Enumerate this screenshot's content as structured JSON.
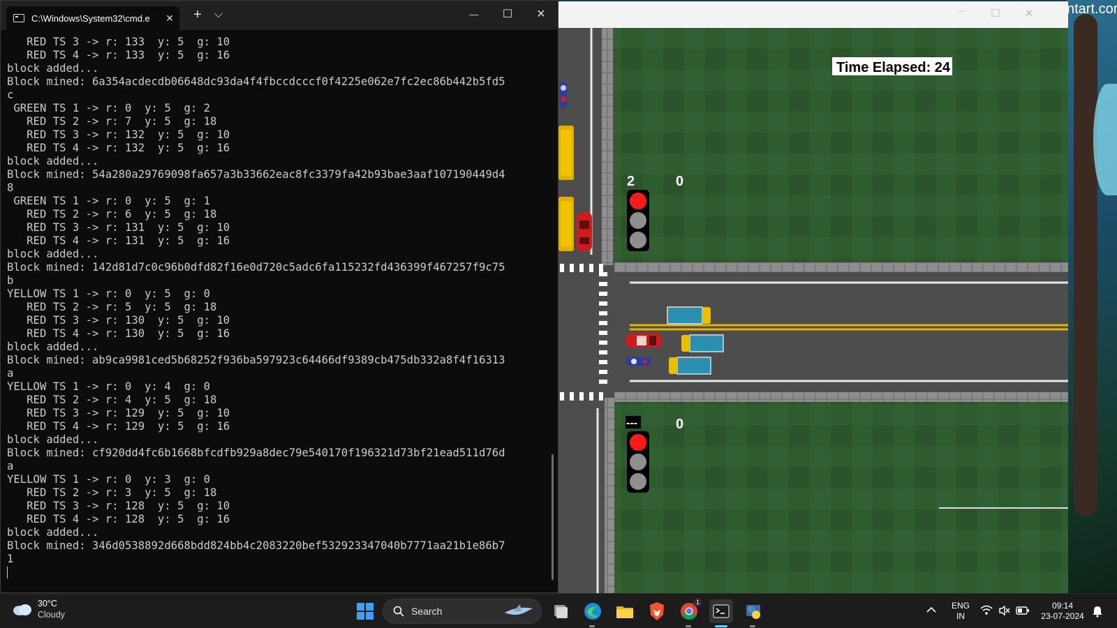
{
  "wallpaper": {
    "brand_text": "ntart.com"
  },
  "terminal": {
    "tab_title": "C:\\Windows\\System32\\cmd.e",
    "tab_close": "✕",
    "new_tab": "+",
    "dropdown": "⌵",
    "minimize": "—",
    "maximize": "☐",
    "close": "✕",
    "lines": [
      "   RED TS 3 -> r: 133  y: 5  g: 10",
      "   RED TS 4 -> r: 133  y: 5  g: 16",
      "block added...",
      "Block mined: 6a354acdecdb06648dc93da4f4fbccdcccf0f4225e062e7fc2ec86b442b5fd5",
      "c",
      " GREEN TS 1 -> r: 0  y: 5  g: 2",
      "   RED TS 2 -> r: 7  y: 5  g: 18",
      "   RED TS 3 -> r: 132  y: 5  g: 10",
      "   RED TS 4 -> r: 132  y: 5  g: 16",
      "block added...",
      "Block mined: 54a280a29769098fa657a3b33662eac8fc3379fa42b93bae3aaf107190449d4",
      "8",
      " GREEN TS 1 -> r: 0  y: 5  g: 1",
      "   RED TS 2 -> r: 6  y: 5  g: 18",
      "   RED TS 3 -> r: 131  y: 5  g: 10",
      "   RED TS 4 -> r: 131  y: 5  g: 16",
      "block added...",
      "Block mined: 142d81d7c0c96b0dfd82f16e0d720c5adc6fa115232fd436399f467257f9c75",
      "b",
      "YELLOW TS 1 -> r: 0  y: 5  g: 0",
      "   RED TS 2 -> r: 5  y: 5  g: 18",
      "   RED TS 3 -> r: 130  y: 5  g: 10",
      "   RED TS 4 -> r: 130  y: 5  g: 16",
      "block added...",
      "Block mined: ab9ca9981ced5b68252f936ba597923c64466df9389cb475db332a8f4f16313",
      "a",
      "YELLOW TS 1 -> r: 0  y: 4  g: 0",
      "   RED TS 2 -> r: 4  y: 5  g: 18",
      "   RED TS 3 -> r: 129  y: 5  g: 10",
      "   RED TS 4 -> r: 129  y: 5  g: 16",
      "block added...",
      "Block mined: cf920dd4fc6b1668bfcdfb929a8dec79e540170f196321d73bf21ead511d76d",
      "a",
      "YELLOW TS 1 -> r: 0  y: 3  g: 0",
      "   RED TS 2 -> r: 3  y: 5  g: 18",
      "   RED TS 3 -> r: 128  y: 5  g: 10",
      "   RED TS 4 -> r: 128  y: 5  g: 16",
      "block added...",
      "Block mined: 346d0538892d668bdd824bb4c2083220bef532923347040b7771aa21b1e86b7",
      "1"
    ]
  },
  "simulation": {
    "minimize": "—",
    "maximize": "☐",
    "close": "✕",
    "time_elapsed": "Time Elapsed: 24",
    "signal_top": {
      "left_value": "2",
      "right_value": "0",
      "state": "red"
    },
    "signal_bottom": {
      "left_value": "---",
      "right_value": "0",
      "state": "red"
    }
  },
  "taskbar": {
    "weather_temp": "30°C",
    "weather_cond": "Cloudy",
    "search_label": "Search",
    "lang_top": "ENG",
    "lang_bottom": "IN",
    "time": "09:14",
    "date": "23-07-2024",
    "chrome_badge": "1"
  },
  "icons": [
    "cmd-icon",
    "windows-start-icon",
    "search-icon",
    "task-view-icon",
    "edge-icon",
    "file-explorer-icon",
    "brave-icon",
    "chrome-icon",
    "terminal-icon",
    "python-icon",
    "chevron-up-icon",
    "wifi-icon",
    "volume-muted-icon",
    "battery-icon",
    "notification-bell-icon",
    "cloud-icon"
  ],
  "colors": {
    "terminal_bg": "#0c0c0c",
    "terminal_text": "#cccccc",
    "grass": "#2d5a2d",
    "road": "#4a4a4a",
    "signal_red": "#ff1a1a",
    "lane_yellow": "#e8b400"
  }
}
